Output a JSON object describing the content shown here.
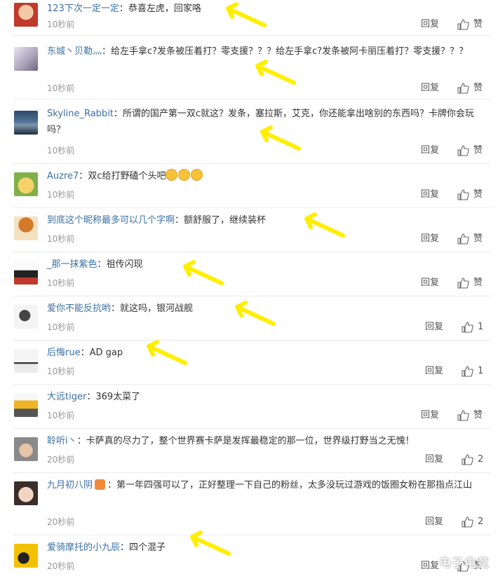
{
  "actions": {
    "reply_label": "回复",
    "like_label": "赞"
  },
  "comments": [
    {
      "name": "123下次一定一定",
      "text": "：恭喜左虎，回家咯",
      "time": "10秒前",
      "likes": ""
    },
    {
      "name": "东城丶贝勒灬",
      "text": "：给左手拿c?发条被压着打？零支援？？？给左手拿c?发条被阿卡丽压着打？零支援？？？",
      "time": "10秒前",
      "likes": ""
    },
    {
      "name": "Skyline_Rabbit",
      "text": "：所谓的国产第一双c就这？发条，塞拉斯，艾克，你还能拿出啥别的东西吗？卡牌你会玩吗？",
      "time": "10秒前",
      "likes": ""
    },
    {
      "name": "Auzre7",
      "text": "：双c给打野磕个头吧",
      "time": "10秒前",
      "likes": ""
    },
    {
      "name": "到底这个昵称最多可以几个字啊",
      "text": "：额舒服了，继续装杯",
      "time": "10秒前",
      "likes": ""
    },
    {
      "name": "_那一抹紫色",
      "text": "：祖传闪现",
      "time": "10秒前",
      "likes": ""
    },
    {
      "name": "爱你不能反抗哟",
      "text": "：就这吗，银河战舰",
      "time": "10秒前",
      "likes": "1"
    },
    {
      "name": "后悔rue",
      "text": "：AD gap",
      "time": "10秒前",
      "likes": "1"
    },
    {
      "name": "大远tiger",
      "text": "：369太菜了",
      "time": "10秒前",
      "likes": ""
    },
    {
      "name": "聆听i丶",
      "text": "：卡萨真的尽力了，整个世界赛卡萨是发挥最稳定的那一位，世界级打野当之无愧！",
      "time": "20秒前",
      "likes": "2"
    },
    {
      "name": "九月初八阴",
      "text": "：第一年四强可以了，正好整理一下自己的粉丝，太多没玩过游戏的饭圈女粉在那指点江山",
      "time": "20秒前",
      "likes": "2"
    },
    {
      "name": "爱骑摩托的小九辰",
      "text": "：四个混子",
      "time": "20秒前",
      "likes": ""
    }
  ],
  "watermark": "电子电竞",
  "colors": {
    "name": "#3a6fa6",
    "arrow": "#ffee00",
    "time": "#999999",
    "separator": "#ececec"
  }
}
